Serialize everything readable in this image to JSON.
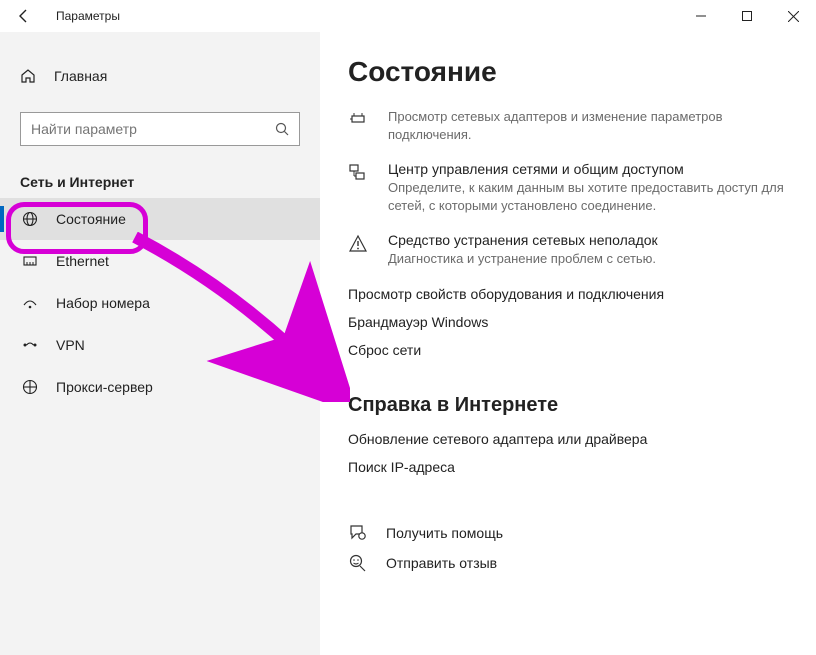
{
  "window": {
    "title": "Параметры"
  },
  "sidebar": {
    "home": "Главная",
    "search_placeholder": "Найти параметр",
    "section": "Сеть и Интернет",
    "items": [
      {
        "label": "Состояние"
      },
      {
        "label": "Ethernet"
      },
      {
        "label": "Набор номера"
      },
      {
        "label": "VPN"
      },
      {
        "label": "Прокси-сервер"
      }
    ]
  },
  "page": {
    "title": "Состояние",
    "options": [
      {
        "title": "Просмотр сетевых адаптеров и изменение параметров подключения."
      },
      {
        "title": "Центр управления сетями и общим доступом",
        "desc": "Определите, к каким данным вы хотите предоставить доступ для сетей, с которыми установлено соединение."
      },
      {
        "title": "Средство устранения сетевых неполадок",
        "desc": "Диагностика и устранение проблем с сетью."
      }
    ],
    "links": [
      "Просмотр свойств оборудования и подключения",
      "Брандмауэр Windows",
      "Сброс сети"
    ],
    "help_header": "Справка в Интернете",
    "help_links": [
      "Обновление сетевого адаптера или драйвера",
      "Поиск IP-адреса"
    ],
    "footer": [
      "Получить помощь",
      "Отправить отзыв"
    ]
  },
  "annotation": {
    "color": "#d600d6"
  }
}
